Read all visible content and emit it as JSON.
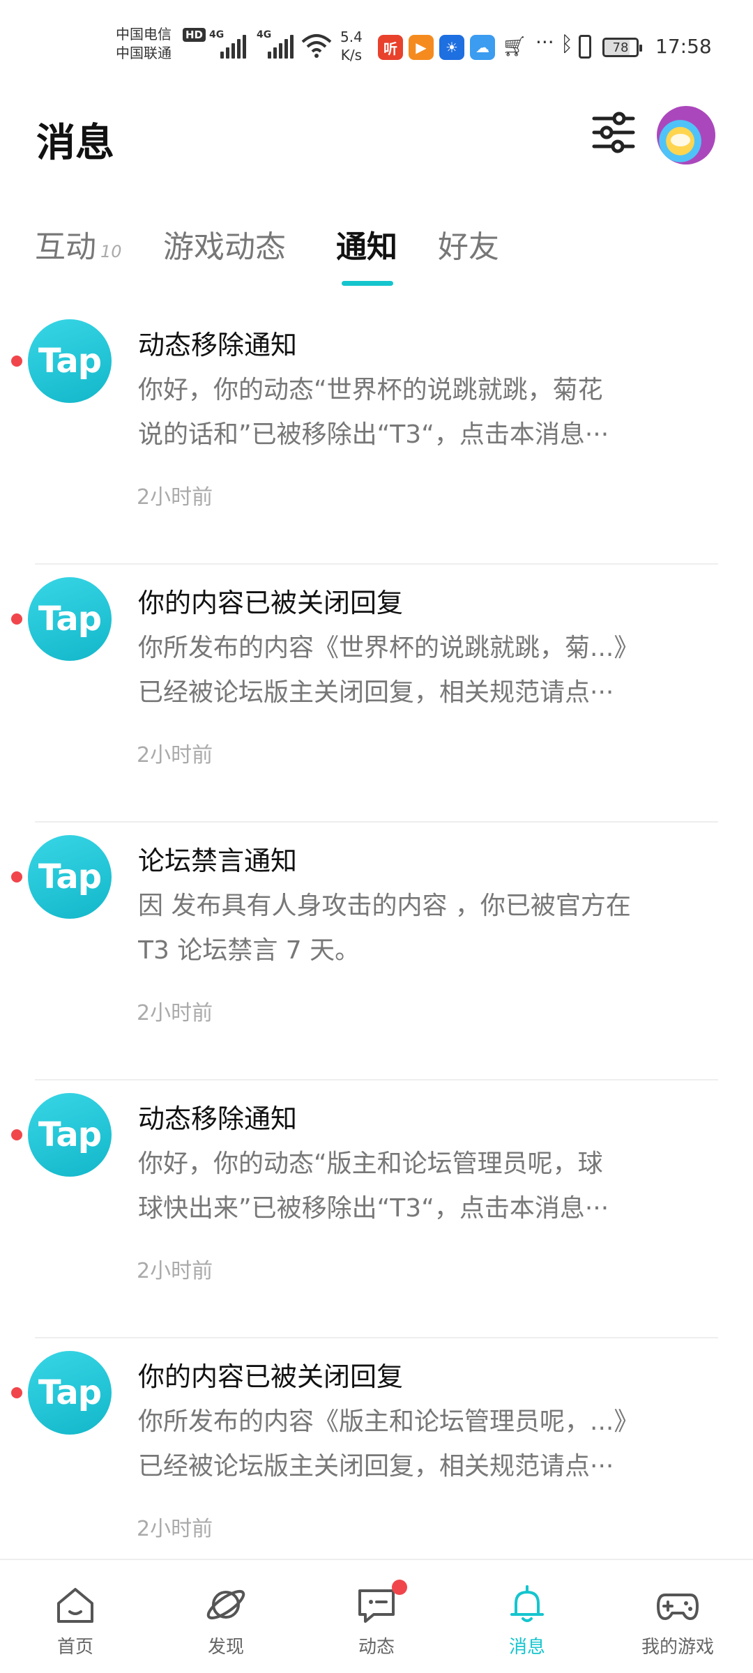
{
  "status_bar": {
    "carrier_1": "中国电信",
    "carrier_2": "中国联通",
    "hd": "HD",
    "signal_1": "4G",
    "signal_2": "4G",
    "net_speed_value": "5.4",
    "net_speed_unit": "K/s",
    "app_icons": [
      "ting-app-icon",
      "video-app-icon",
      "bulb-app-icon",
      "cloud-app-icon"
    ],
    "app_icon_colors": [
      "#e8412c",
      "#f58b1f",
      "#1e6fe0",
      "#3b9cf0"
    ],
    "ting_label": "听",
    "battery": "78",
    "time": "17:58"
  },
  "header": {
    "title": "消息"
  },
  "tabs": [
    {
      "label": "互动",
      "count": "10"
    },
    {
      "label": "游戏动态"
    },
    {
      "label": "通知",
      "active": true
    },
    {
      "label": "好友"
    }
  ],
  "notifications": [
    {
      "logo": "Tap",
      "title": "动态移除通知",
      "line1": "你好，你的动态“世界杯的说跳就跳，菊花",
      "line2": "说的话和”已被移除出“T3“，点击本消息···",
      "time": "2小时前"
    },
    {
      "logo": "Tap",
      "title": "你的内容已被关闭回复",
      "line1": "你所发布的内容《世界杯的说跳就跳，菊...》",
      "line2": "已经被论坛版主关闭回复，相关规范请点···",
      "time": "2小时前"
    },
    {
      "logo": "Tap",
      "title": "论坛禁言通知",
      "line1": "因 发布具有人身攻击的内容 ，你已被官方在",
      "line2": "T3 论坛禁言 7 天。",
      "time": "2小时前"
    },
    {
      "logo": "Tap",
      "title": "动态移除通知",
      "line1": "你好，你的动态“版主和论坛管理员呢，球",
      "line2": "球快出来”已被移除出“T3“，点击本消息···",
      "time": "2小时前"
    },
    {
      "logo": "Tap",
      "title": "你的内容已被关闭回复",
      "line1": "你所发布的内容《版主和论坛管理员呢，...》",
      "line2": "已经被论坛版主关闭回复，相关规范请点···",
      "time": "2小时前"
    }
  ],
  "bottom_nav": [
    {
      "label": "首页",
      "icon": "home-icon"
    },
    {
      "label": "发现",
      "icon": "planet-icon"
    },
    {
      "label": "动态",
      "icon": "chat-icon",
      "badge": true
    },
    {
      "label": "消息",
      "icon": "bell-icon",
      "active": true
    },
    {
      "label": "我的游戏",
      "icon": "gamepad-icon"
    }
  ],
  "colors": {
    "accent": "#15c5ce",
    "unread": "#f0464b",
    "secondary_text": "#777777"
  }
}
